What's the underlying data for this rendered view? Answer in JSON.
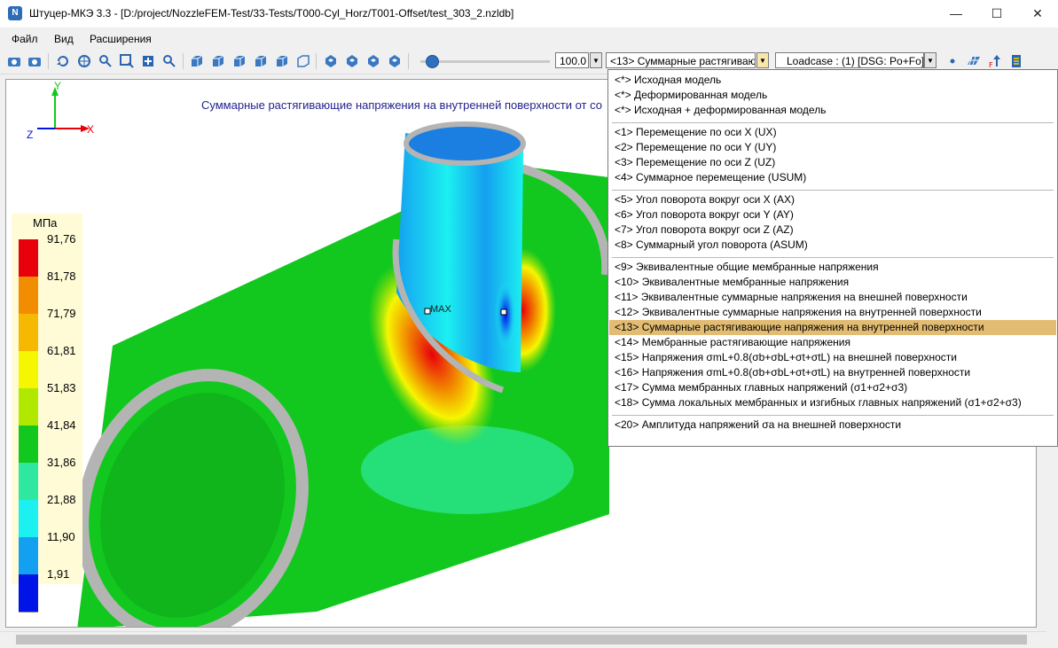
{
  "window": {
    "app_icon_letter": "N",
    "title": "Штуцер-МКЭ 3.3 - [D:/project/NozzleFEM-Test/33-Tests/T000-Cyl_Horz/T001-Offset/test_303_2.nzldb]",
    "minimize": "—",
    "maximize": "☐",
    "close": "✕"
  },
  "menu": {
    "file": "Файл",
    "view": "Вид",
    "extensions": "Расширения"
  },
  "toolbar": {
    "zoom_value": "100.0",
    "result_selector": "<13> Суммарные растягиваю",
    "loadcase_selector": "Loadcase : (1) [DSG: Po+Fo]"
  },
  "viewport": {
    "title": "Суммарные растягивающие напряжения на внутренней поверхности от со",
    "axes": {
      "x": "X",
      "y": "Y",
      "z": "Z"
    },
    "max_marker": "MAX",
    "legend": {
      "unit": "МПа",
      "values": [
        "91,76",
        "81,78",
        "71,79",
        "61,81",
        "51,83",
        "41,84",
        "31,86",
        "21,88",
        "11,90",
        "1,91"
      ],
      "colors": [
        "#e8000b",
        "#f28c00",
        "#f6b800",
        "#f6f600",
        "#b0e800",
        "#12c81e",
        "#2ee8a0",
        "#1cf0f0",
        "#14a0f0",
        "#0014e8"
      ]
    }
  },
  "dropdown": {
    "items": [
      {
        "label": "<*> Исходная модель"
      },
      {
        "label": "<*> Деформированная модель"
      },
      {
        "label": "<*> Исходная + деформированная модель"
      },
      {
        "label": "<1> Перемещение по оси X (UX)"
      },
      {
        "label": "<2> Перемещение по оси Y (UY)"
      },
      {
        "label": "<3> Перемещение по оси Z (UZ)"
      },
      {
        "label": "<4> Суммарное перемещение (USUM)"
      },
      {
        "label": "<5> Угол поворота вокруг оси X (AX)"
      },
      {
        "label": "<6> Угол поворота вокруг оси Y (AY)"
      },
      {
        "label": "<7> Угол поворота вокруг оси Z (AZ)"
      },
      {
        "label": "<8> Суммарный угол поворота (ASUM)"
      },
      {
        "label": "<9> Эквивалентные общие мембранные напряжения"
      },
      {
        "label": "<10> Эквивалентные мембранные напряжения"
      },
      {
        "label": "<11> Эквивалентные суммарные напряжения на внешней поверхности"
      },
      {
        "label": "<12> Эквивалентные суммарные напряжения на внутренней поверхности"
      },
      {
        "label": "<13> Суммарные растягивающие напряжения на внутренней поверхности"
      },
      {
        "label": "<14> Мембранные растягивающие напряжения"
      },
      {
        "label": "<15> Напряжения σmL+0.8(σb+σbL+σt+σtL) на внешней поверхности"
      },
      {
        "label": "<16> Напряжения σmL+0.8(σb+σbL+σt+σtL) на внутренней поверхности"
      },
      {
        "label": "<17> Сумма мембранных главных напряжений (σ1+σ2+σ3)"
      },
      {
        "label": "<18> Сумма локальных мембранных и изгибных главных напряжений (σ1+σ2+σ3)"
      },
      {
        "label": "<20> Амплитуда напряжений σa на внешней поверхности"
      }
    ],
    "selected_index": 15
  },
  "colors": {
    "accent": "#2f6fbd",
    "selected_item": "#e2bc73",
    "title_text": "#1f1f8f"
  }
}
